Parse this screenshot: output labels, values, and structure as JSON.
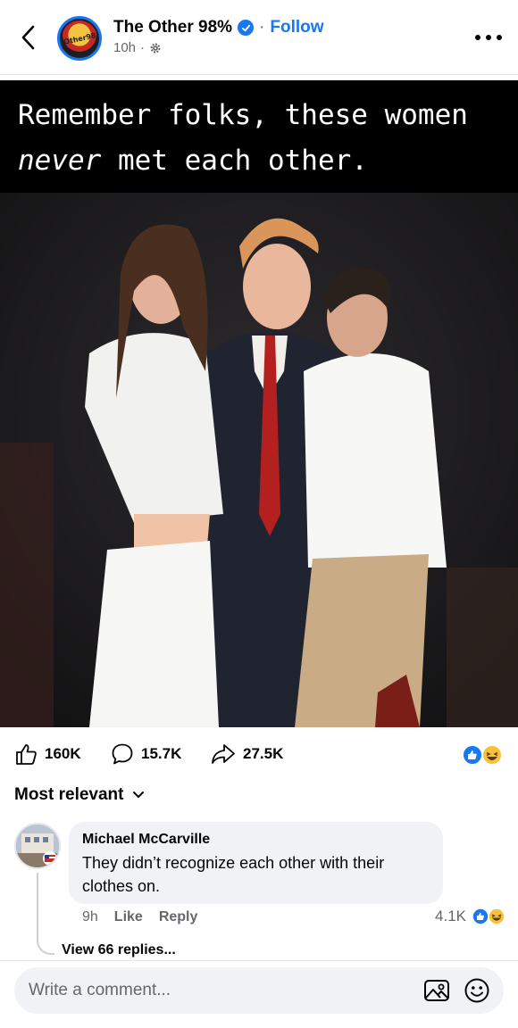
{
  "header": {
    "page_name": "The Other 98%",
    "follow_label": "Follow",
    "separator": "·",
    "time": "10h",
    "meta_separator": "·",
    "avatar_text": "Other98",
    "icons": {
      "back": "chevron-left-icon",
      "verified": "verified-badge-icon",
      "audience": "gear-icon",
      "more": "more-dots-icon"
    }
  },
  "post": {
    "caption_line1": "Remember folks, these women",
    "caption_line2_em": "never",
    "caption_line2_rest": " met each other.",
    "photo_description": "photo of three people"
  },
  "actions": {
    "likes": "160K",
    "comments": "15.7K",
    "shares": "27.5K",
    "reaction_icons": [
      "like-reaction-icon",
      "haha-reaction-icon"
    ]
  },
  "comments_section": {
    "sort_label": "Most relevant",
    "comment": {
      "author": "Michael McCarville",
      "text": "They didn’t recognize each other with their clothes on.",
      "time": "9h",
      "like_label": "Like",
      "reply_label": "Reply",
      "reaction_count": "4.1K"
    },
    "view_replies": "View 66 replies..."
  },
  "composer": {
    "placeholder": "Write a comment...",
    "icons": [
      "photo-icon",
      "emoji-icon"
    ]
  },
  "colors": {
    "accent": "#1877f2",
    "text_primary": "#050505",
    "text_secondary": "#65676b",
    "bubble_bg": "#f0f2f5",
    "haha_yellow": "#f7c13b"
  }
}
